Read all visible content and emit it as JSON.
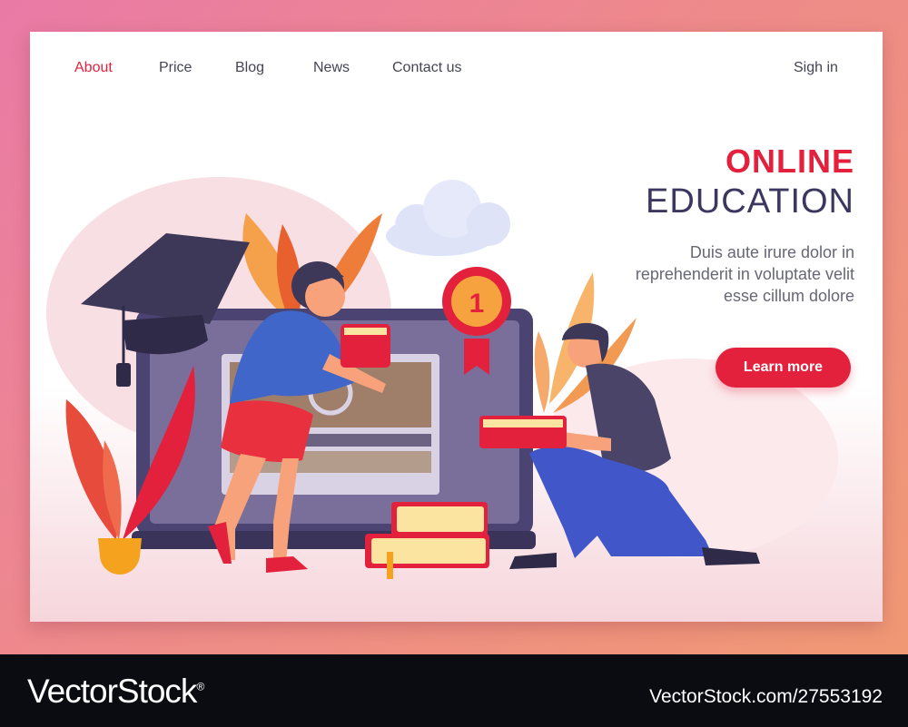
{
  "nav": {
    "items": [
      {
        "label": "About",
        "active": true
      },
      {
        "label": "Price",
        "active": false
      },
      {
        "label": "Blog",
        "active": false
      },
      {
        "label": "News",
        "active": false
      },
      {
        "label": "Contact us",
        "active": false
      }
    ],
    "signin_label": "Sigh in"
  },
  "hero": {
    "title_line1": "ONLINE",
    "title_line2": "EDUCATION",
    "description": "Duis aute irure dolor in reprehenderit in voluptate velit esse cillum dolore",
    "cta_label": "Learn more"
  },
  "illustration": {
    "medal_number": "1"
  },
  "watermark": {
    "brand": "VectorStock",
    "registered": "®",
    "url": "VectorStock.com/27553192"
  },
  "colors": {
    "accent": "#e3213d",
    "heading_dark": "#3b3760",
    "laptop": "#4b4371",
    "background_gradient_start": "#e97aa6",
    "background_gradient_end": "#f09a72"
  }
}
